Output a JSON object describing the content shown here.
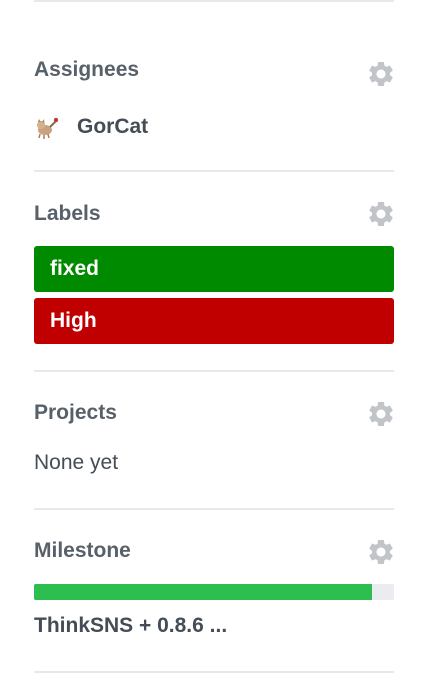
{
  "assignees": {
    "heading": "Assignees",
    "settings_icon": "gear-icon",
    "users": [
      {
        "name": "GorCat",
        "avatar_icon": "cat-avatar"
      }
    ]
  },
  "labels": {
    "heading": "Labels",
    "settings_icon": "gear-icon",
    "items": [
      {
        "name": "fixed",
        "color": "#008a00"
      },
      {
        "name": "High",
        "color": "#c00000"
      }
    ]
  },
  "projects": {
    "heading": "Projects",
    "settings_icon": "gear-icon",
    "status": "None yet"
  },
  "milestone": {
    "heading": "Milestone",
    "settings_icon": "gear-icon",
    "progress_percent": 94,
    "progress_color": "#2cbe4e",
    "title": "ThinkSNS + 0.8.6 ..."
  }
}
